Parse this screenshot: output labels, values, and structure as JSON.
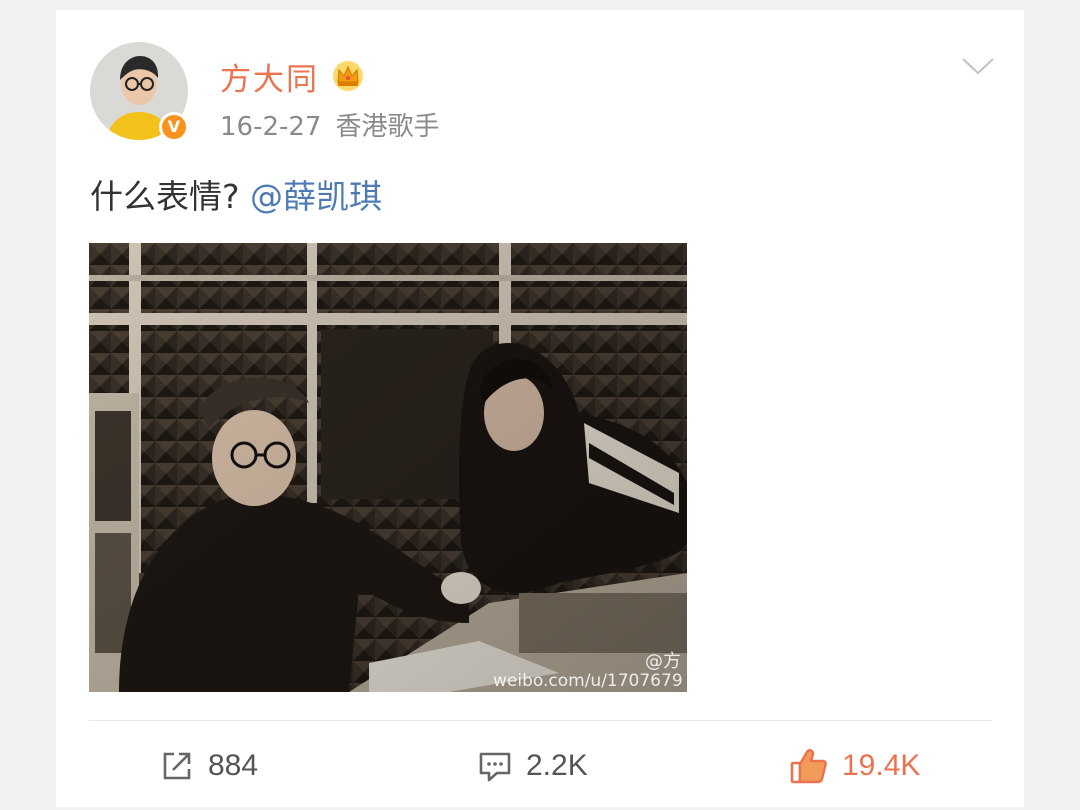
{
  "post": {
    "username": "方大同",
    "date": "16-2-27",
    "source": "香港歌手",
    "text": "什么表情? ",
    "mention": "@薛凯琪",
    "verified_badge": "V",
    "icons": [
      "verified-badge-icon",
      "crown-icon",
      "chevron-down-icon",
      "repost-icon",
      "comment-icon",
      "like-icon"
    ]
  },
  "image": {
    "watermark_handle": "@方",
    "watermark_url": "weibo.com/u/1707679"
  },
  "actions": {
    "repost_count": "884",
    "comment_count": "2.2K",
    "like_count": "19.4K"
  },
  "colors": {
    "username": "#eb7350",
    "mention": "#4f7bb5",
    "like": "#eb7350",
    "verified": "#f7921e"
  }
}
